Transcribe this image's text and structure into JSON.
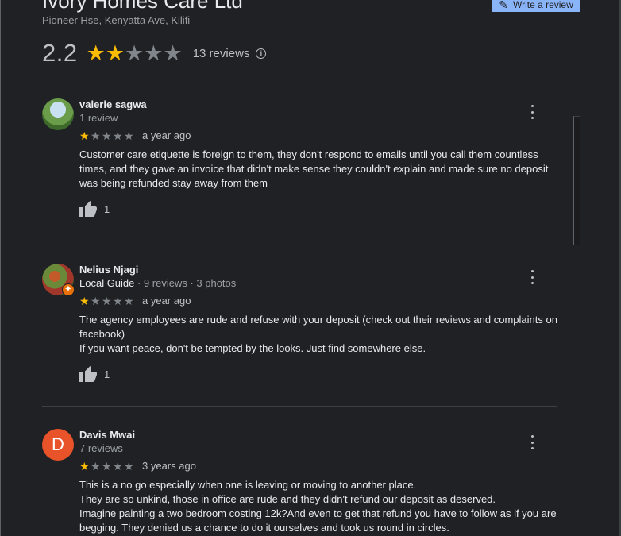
{
  "business": {
    "name": "Ivory Homes Care Ltd",
    "address": "Pioneer Hse, Kenyatta Ave, Kilifi",
    "write_review_label": "Write a review",
    "rating": "2.2",
    "stars_filled": 2,
    "reviews_count_label": "13 reviews"
  },
  "colors": {
    "star_on": "#fbbc04",
    "star_off": "#80868b",
    "accent": "#8ab4f8",
    "avatar_letter_bg": "#e8532a"
  },
  "reviews": [
    {
      "author": "valerie sagwa",
      "meta_guide": "",
      "meta": "1 review",
      "stars": 1,
      "time": "a year ago",
      "text": [
        "Customer care etiquette is foreign to them, they don't respond to emails until you call them countless times, and they gave an invoice that didn't make sense they couldn't explain and made sure no deposit was being refunded stay away from them"
      ],
      "likes": "1"
    },
    {
      "author": "Nelius Njagi",
      "meta_guide": "Local Guide",
      "meta": " · 9 reviews · 3 photos",
      "stars": 1,
      "time": "a year ago",
      "text": [
        "The agency employees are rude and refuse with your deposit (check out their reviews and complaints on facebook)",
        "If you want peace, don't be tempted by the looks. Just find somewhere else."
      ],
      "likes": "1"
    },
    {
      "author": "Davis Mwai",
      "avatar_letter": "D",
      "meta_guide": "",
      "meta": "7 reviews",
      "stars": 1,
      "time": "3 years ago",
      "text": [
        "This is a no go especially when one is leaving or moving to another place.",
        "They are so unkind, those in office are rude and they didn't refund our deposit as deserved.",
        "Imagine painting a two bedroom costing 12k?And even to get that refund you have to follow as if you are begging. They denied us a chance to do it ourselves and took us round in circles."
      ],
      "likes": ""
    }
  ]
}
